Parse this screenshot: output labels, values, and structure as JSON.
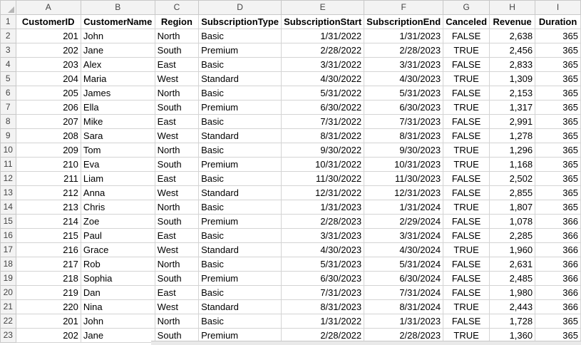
{
  "sheet": {
    "col_letters": [
      "A",
      "B",
      "C",
      "D",
      "E",
      "F",
      "G",
      "H",
      "I"
    ],
    "headers": [
      "CustomerID",
      "CustomerName",
      "Region",
      "SubscriptionType",
      "SubscriptionStart",
      "SubscriptionEnd",
      "Canceled",
      "Revenue",
      "Duration"
    ],
    "row_numbers": [
      "1",
      "2",
      "3",
      "4",
      "5",
      "6",
      "7",
      "8",
      "9",
      "10",
      "11",
      "12",
      "13",
      "14",
      "15",
      "16",
      "17",
      "18",
      "19",
      "20",
      "21",
      "22",
      "23"
    ],
    "rows": [
      [
        "201",
        "John",
        "North",
        "Basic",
        "1/31/2022",
        "1/31/2023",
        "FALSE",
        "2,638",
        "365"
      ],
      [
        "202",
        "Jane",
        "South",
        "Premium",
        "2/28/2022",
        "2/28/2023",
        "TRUE",
        "2,456",
        "365"
      ],
      [
        "203",
        "Alex",
        "East",
        "Basic",
        "3/31/2022",
        "3/31/2023",
        "FALSE",
        "2,833",
        "365"
      ],
      [
        "204",
        "Maria",
        "West",
        "Standard",
        "4/30/2022",
        "4/30/2023",
        "TRUE",
        "1,309",
        "365"
      ],
      [
        "205",
        "James",
        "North",
        "Basic",
        "5/31/2022",
        "5/31/2023",
        "FALSE",
        "2,153",
        "365"
      ],
      [
        "206",
        "Ella",
        "South",
        "Premium",
        "6/30/2022",
        "6/30/2023",
        "TRUE",
        "1,317",
        "365"
      ],
      [
        "207",
        "Mike",
        "East",
        "Basic",
        "7/31/2022",
        "7/31/2023",
        "FALSE",
        "2,991",
        "365"
      ],
      [
        "208",
        "Sara",
        "West",
        "Standard",
        "8/31/2022",
        "8/31/2023",
        "FALSE",
        "1,278",
        "365"
      ],
      [
        "209",
        "Tom",
        "North",
        "Basic",
        "9/30/2022",
        "9/30/2023",
        "TRUE",
        "1,296",
        "365"
      ],
      [
        "210",
        "Eva",
        "South",
        "Premium",
        "10/31/2022",
        "10/31/2023",
        "TRUE",
        "1,168",
        "365"
      ],
      [
        "211",
        "Liam",
        "East",
        "Basic",
        "11/30/2022",
        "11/30/2023",
        "FALSE",
        "2,502",
        "365"
      ],
      [
        "212",
        "Anna",
        "West",
        "Standard",
        "12/31/2022",
        "12/31/2023",
        "FALSE",
        "2,855",
        "365"
      ],
      [
        "213",
        "Chris",
        "North",
        "Basic",
        "1/31/2023",
        "1/31/2024",
        "TRUE",
        "1,807",
        "365"
      ],
      [
        "214",
        "Zoe",
        "South",
        "Premium",
        "2/28/2023",
        "2/29/2024",
        "FALSE",
        "1,078",
        "366"
      ],
      [
        "215",
        "Paul",
        "East",
        "Basic",
        "3/31/2023",
        "3/31/2024",
        "FALSE",
        "2,285",
        "366"
      ],
      [
        "216",
        "Grace",
        "West",
        "Standard",
        "4/30/2023",
        "4/30/2024",
        "TRUE",
        "1,960",
        "366"
      ],
      [
        "217",
        "Rob",
        "North",
        "Basic",
        "5/31/2023",
        "5/31/2024",
        "FALSE",
        "2,631",
        "366"
      ],
      [
        "218",
        "Sophia",
        "South",
        "Premium",
        "6/30/2023",
        "6/30/2024",
        "FALSE",
        "2,485",
        "366"
      ],
      [
        "219",
        "Dan",
        "East",
        "Basic",
        "7/31/2023",
        "7/31/2024",
        "FALSE",
        "1,980",
        "366"
      ],
      [
        "220",
        "Nina",
        "West",
        "Standard",
        "8/31/2023",
        "8/31/2024",
        "TRUE",
        "2,443",
        "366"
      ],
      [
        "201",
        "John",
        "North",
        "Basic",
        "1/31/2022",
        "1/31/2023",
        "FALSE",
        "1,728",
        "365"
      ],
      [
        "202",
        "Jane",
        "South",
        "Premium",
        "2/28/2022",
        "2/28/2023",
        "TRUE",
        "1,360",
        "365"
      ]
    ],
    "colors": {
      "header_bg": "#f3f3f3",
      "gridline": "#d4d4d4"
    }
  }
}
